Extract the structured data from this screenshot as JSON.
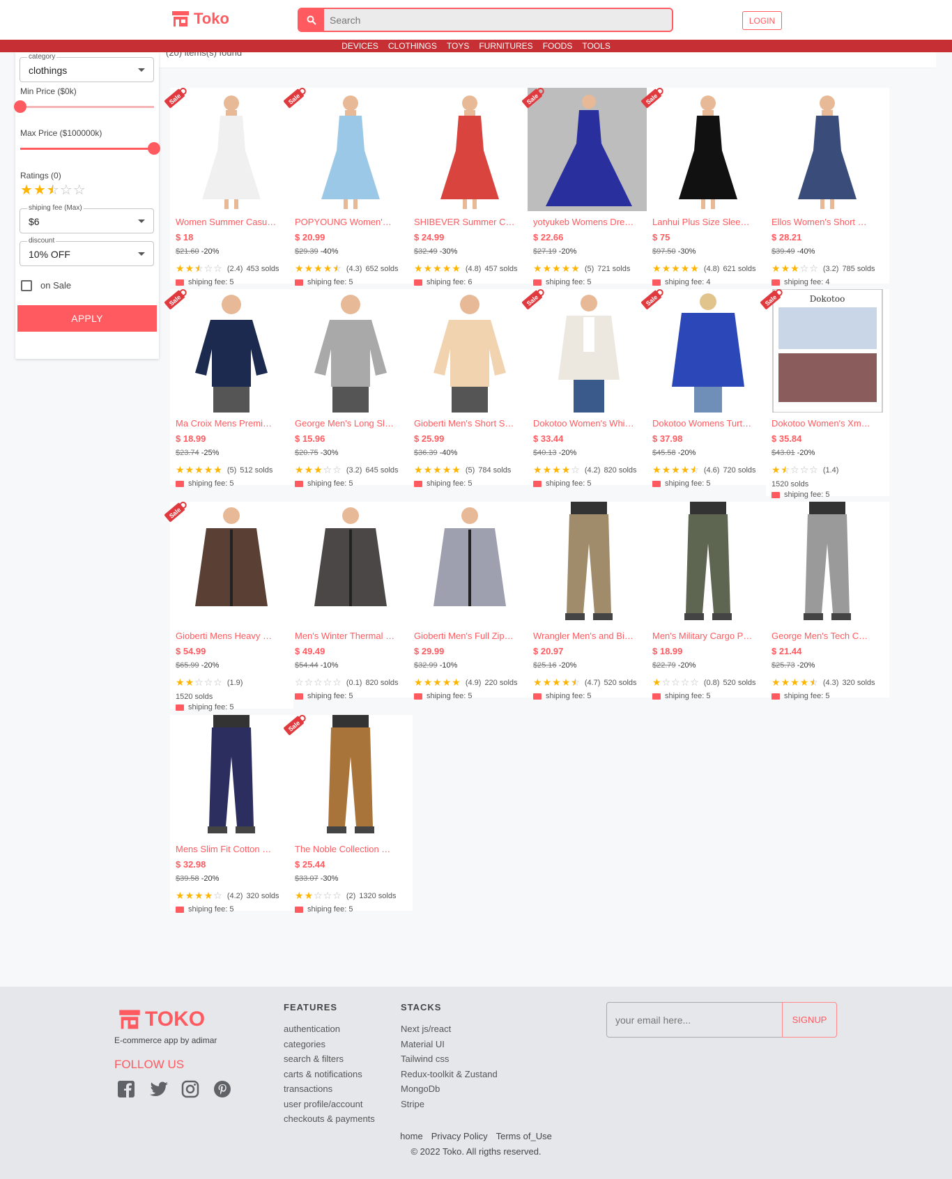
{
  "header": {
    "brand": "Toko",
    "search_placeholder": "Search",
    "login_label": "LOGIN",
    "nav": [
      "DEVICES",
      "CLOTHINGS",
      "TOYS",
      "FURNITURES",
      "FOODS",
      "TOOLS"
    ],
    "items_found": "(20) items(s) found"
  },
  "filters": {
    "category_label": "category",
    "category_value": "clothings",
    "min_price_label": "Min Price ($0k)",
    "min_price_fraction": 0.0,
    "max_price_label": "Max Price ($100000k)",
    "max_price_fraction": 1.0,
    "ratings_label": "Ratings (0)",
    "ratings_stars": 2.5,
    "shipping_label": "shiping fee (Max)",
    "shipping_value": "$6",
    "discount_label": "discount",
    "discount_value": "10% OFF",
    "on_sale_label": "on Sale",
    "on_sale_checked": false,
    "apply_label": "APPLY"
  },
  "products": [
    {
      "title": "Women Summer Casu…",
      "price": "$ 18",
      "orig": "$21.60",
      "off": "-20%",
      "stars": 2.5,
      "rating": "(2.4)",
      "solds": "453 solds",
      "ship": "shiping fee: 5",
      "sale": true,
      "icon": "dress-icon",
      "color": "#f0f0f0"
    },
    {
      "title": "POPYOUNG Women'…",
      "price": "$ 20.99",
      "orig": "$29.39",
      "off": "-40%",
      "stars": 4.5,
      "rating": "(4.3)",
      "solds": "652 solds",
      "ship": "shiping fee: 5",
      "sale": true,
      "icon": "dress-icon",
      "color": "#9cc8e8"
    },
    {
      "title": "SHIBEVER Summer C…",
      "price": "$ 24.99",
      "orig": "$32.49",
      "off": "-30%",
      "stars": 5,
      "rating": "(4.8)",
      "solds": "457 solds",
      "ship": "shiping fee: 6",
      "sale": false,
      "icon": "dress-icon",
      "color": "#d9443e"
    },
    {
      "title": "yotyukeb Womens Dre…",
      "price": "$ 22.66",
      "orig": "$27.19",
      "off": "-20%",
      "stars": 5,
      "rating": "(5)",
      "solds": "721 solds",
      "ship": "shiping fee: 5",
      "sale": true,
      "icon": "gown-icon",
      "color": "#2a2f9e"
    },
    {
      "title": "Lanhui Plus Size Slee…",
      "price": "$ 75",
      "orig": "$97.50",
      "off": "-30%",
      "stars": 5,
      "rating": "(4.8)",
      "solds": "621 solds",
      "ship": "shiping fee: 4",
      "sale": true,
      "icon": "dress-icon",
      "color": "#111111"
    },
    {
      "title": "Ellos Women's Short …",
      "price": "$ 28.21",
      "orig": "$39.49",
      "off": "-40%",
      "stars": 3,
      "rating": "(3.2)",
      "solds": "785 solds",
      "ship": "shiping fee: 4",
      "sale": false,
      "icon": "dress-icon",
      "color": "#3a4d7a"
    },
    {
      "title": "Ma Croix Mens Premi…",
      "price": "$ 18.99",
      "orig": "$23.74",
      "off": "-25%",
      "stars": 5,
      "rating": "(5)",
      "solds": "512 solds",
      "ship": "shiping fee: 5",
      "sale": true,
      "icon": "shirt-icon",
      "color": "#1b2a4e"
    },
    {
      "title": "George Men's Long Sl…",
      "price": "$ 15.96",
      "orig": "$20.75",
      "off": "-30%",
      "stars": 3,
      "rating": "(3.2)",
      "solds": "645 solds",
      "ship": "shiping fee: 5",
      "sale": false,
      "icon": "shirt-icon",
      "color": "#a9a9a9"
    },
    {
      "title": "Gioberti Men's Short S…",
      "price": "$ 25.99",
      "orig": "$36.39",
      "off": "-40%",
      "stars": 5,
      "rating": "(5)",
      "solds": "784 solds",
      "ship": "shiping fee: 5",
      "sale": false,
      "icon": "shirt-icon",
      "color": "#f2d3b0"
    },
    {
      "title": "Dokotoo Women's Whi…",
      "price": "$ 33.44",
      "orig": "$40.13",
      "off": "-20%",
      "stars": 4,
      "rating": "(4.2)",
      "solds": "820 solds",
      "ship": "shiping fee: 5",
      "sale": true,
      "icon": "cardigan-icon",
      "color": "#ece8e0"
    },
    {
      "title": "Dokotoo Womens Turt…",
      "price": "$ 37.98",
      "orig": "$45.58",
      "off": "-20%",
      "stars": 4.5,
      "rating": "(4.6)",
      "solds": "720 solds",
      "ship": "shiping fee: 5",
      "sale": true,
      "icon": "sweater-icon",
      "color": "#2c47b8"
    },
    {
      "title": "Dokotoo Women's Xm…",
      "price": "$ 35.84",
      "orig": "$43.01",
      "off": "-20%",
      "stars": 1.5,
      "rating": "(1.4)",
      "solds": "1520 solds",
      "ship": "shiping fee: 5",
      "sale": true,
      "icon": "size-chart-icon",
      "color": "#c9d6e8",
      "wrap": true
    },
    {
      "title": "Gioberti Mens Heavy …",
      "price": "$ 54.99",
      "orig": "$65.99",
      "off": "-20%",
      "stars": 2,
      "rating": "(1.9)",
      "solds": "1520 solds",
      "ship": "shiping fee: 5",
      "sale": true,
      "icon": "jacket-icon",
      "color": "#5a4034",
      "wrap": true
    },
    {
      "title": "Men's Winter Thermal …",
      "price": "$ 49.49",
      "orig": "$54.44",
      "off": "-10%",
      "stars": 0,
      "rating": "(0.1)",
      "solds": "820 solds",
      "ship": "shiping fee: 5",
      "sale": false,
      "icon": "jacket-icon",
      "color": "#4a4746"
    },
    {
      "title": "Gioberti Men's Full Zip…",
      "price": "$ 29.99",
      "orig": "$32.99",
      "off": "-10%",
      "stars": 5,
      "rating": "(4.9)",
      "solds": "220 solds",
      "ship": "shiping fee: 5",
      "sale": false,
      "icon": "jacket-icon",
      "color": "#9ea0b0"
    },
    {
      "title": "Wrangler Men's and Bi…",
      "price": "$ 20.97",
      "orig": "$25.16",
      "off": "-20%",
      "stars": 4.5,
      "rating": "(4.7)",
      "solds": "520 solds",
      "ship": "shiping fee: 5",
      "sale": false,
      "icon": "pants-icon",
      "color": "#a08b6a"
    },
    {
      "title": "Men's Military Cargo P…",
      "price": "$ 18.99",
      "orig": "$22.79",
      "off": "-20%",
      "stars": 1,
      "rating": "(0.8)",
      "solds": "520 solds",
      "ship": "shiping fee: 5",
      "sale": false,
      "icon": "pants-icon",
      "color": "#5e6550"
    },
    {
      "title": "George Men's Tech C…",
      "price": "$ 21.44",
      "orig": "$25.73",
      "off": "-20%",
      "stars": 4.5,
      "rating": "(4.3)",
      "solds": "320 solds",
      "ship": "shiping fee: 5",
      "sale": false,
      "icon": "pants-icon",
      "color": "#9a9a9a"
    },
    {
      "title": "Mens Slim Fit Cotton …",
      "price": "$ 32.98",
      "orig": "$39.58",
      "off": "-20%",
      "stars": 4,
      "rating": "(4.2)",
      "solds": "320 solds",
      "ship": "shiping fee: 5",
      "sale": false,
      "icon": "pants-icon",
      "color": "#2b2e5e"
    },
    {
      "title": "The Noble Collection …",
      "price": "$ 25.44",
      "orig": "$33.07",
      "off": "-30%",
      "stars": 2,
      "rating": "(2)",
      "solds": "1320 solds",
      "ship": "shiping fee: 5",
      "sale": true,
      "icon": "pants-icon",
      "color": "#a8743a"
    }
  ],
  "footer": {
    "brand": "TOKO",
    "tagline": "E-commerce app by adimar",
    "follow": "FOLLOW US",
    "socials": [
      "facebook-icon",
      "twitter-icon",
      "instagram-icon",
      "pinterest-icon"
    ],
    "features_title": "FEATURES",
    "features": [
      "authentication",
      "categories",
      "search & filters",
      "carts & notifications",
      "transactions",
      "user profile/account",
      "checkouts & payments"
    ],
    "stacks_title": "STACKS",
    "stacks": [
      "Next js/react",
      "Material UI",
      "Tailwind css",
      "Redux-toolkit & Zustand",
      "MongoDb",
      "Stripe"
    ],
    "email_placeholder": "your email here...",
    "signup_label": "SIGNUP",
    "links": [
      "home",
      "Privacy Policy",
      "Terms of_Use"
    ],
    "copyright": "© 2022 Toko. All rigths reserved."
  }
}
